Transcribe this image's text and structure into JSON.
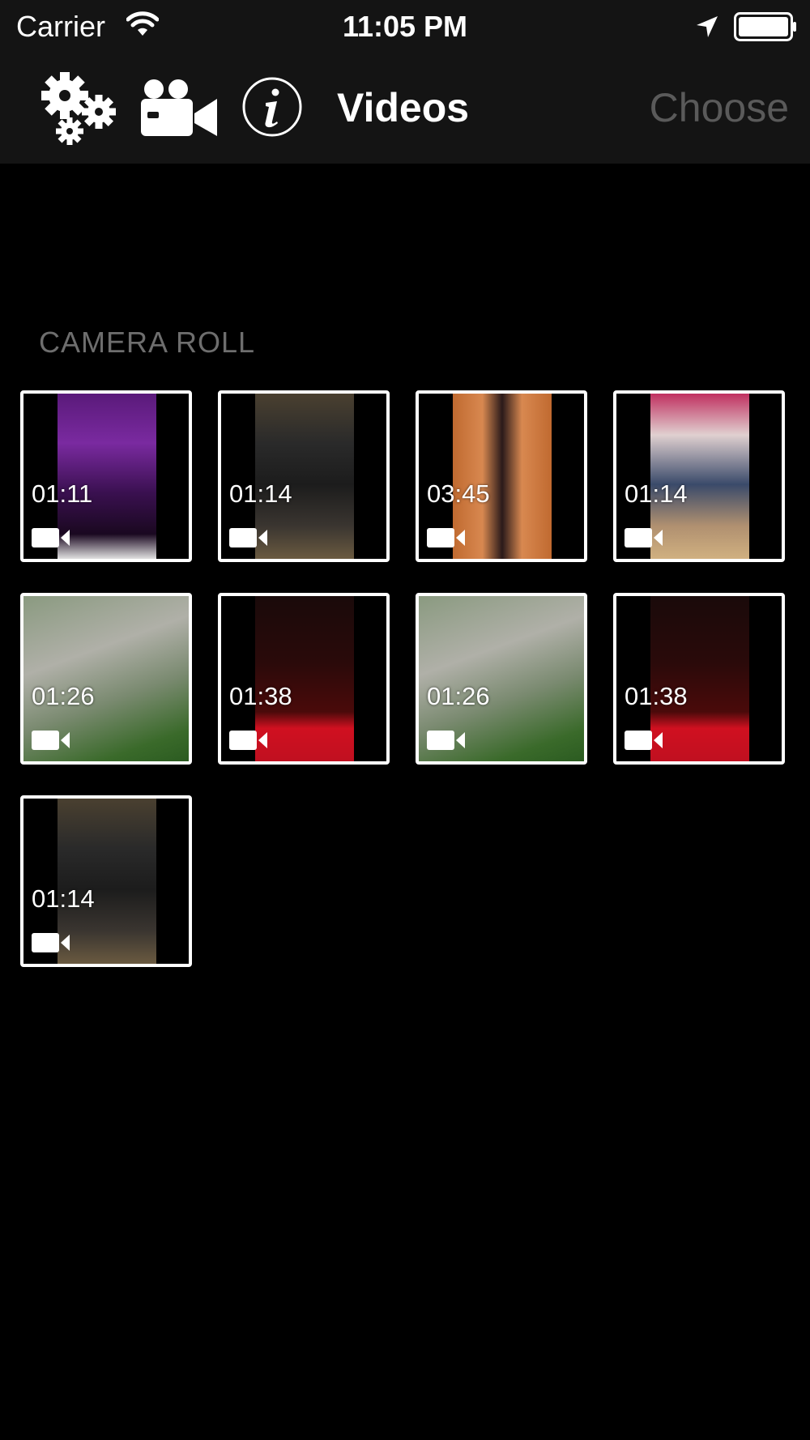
{
  "status_bar": {
    "carrier": "Carrier",
    "time": "11:05 PM",
    "icons": [
      "wifi-icon",
      "location-arrow-icon",
      "battery-icon"
    ]
  },
  "nav": {
    "icons": [
      "gear-icon",
      "camcorder-icon",
      "info-icon"
    ],
    "title": "Videos",
    "choose_label": "Choose",
    "colors": {
      "background": "#141414",
      "choose_disabled": "#5a5a5a"
    }
  },
  "section": {
    "title": "CAMERA ROLL"
  },
  "videos": [
    {
      "duration": "01:11",
      "thumb": "purple-stage-performance"
    },
    {
      "duration": "01:14",
      "thumb": "dance-class-group"
    },
    {
      "duration": "03:45",
      "thumb": "dancer-ornate-backdrop"
    },
    {
      "duration": "01:14",
      "thumb": "dance-studio"
    },
    {
      "duration": "01:26",
      "thumb": "aerial-city-view"
    },
    {
      "duration": "01:38",
      "thumb": "red-stage-show"
    },
    {
      "duration": "01:26",
      "thumb": "aerial-city-view"
    },
    {
      "duration": "01:38",
      "thumb": "red-stage-show"
    },
    {
      "duration": "01:14",
      "thumb": "dance-class-group"
    }
  ]
}
